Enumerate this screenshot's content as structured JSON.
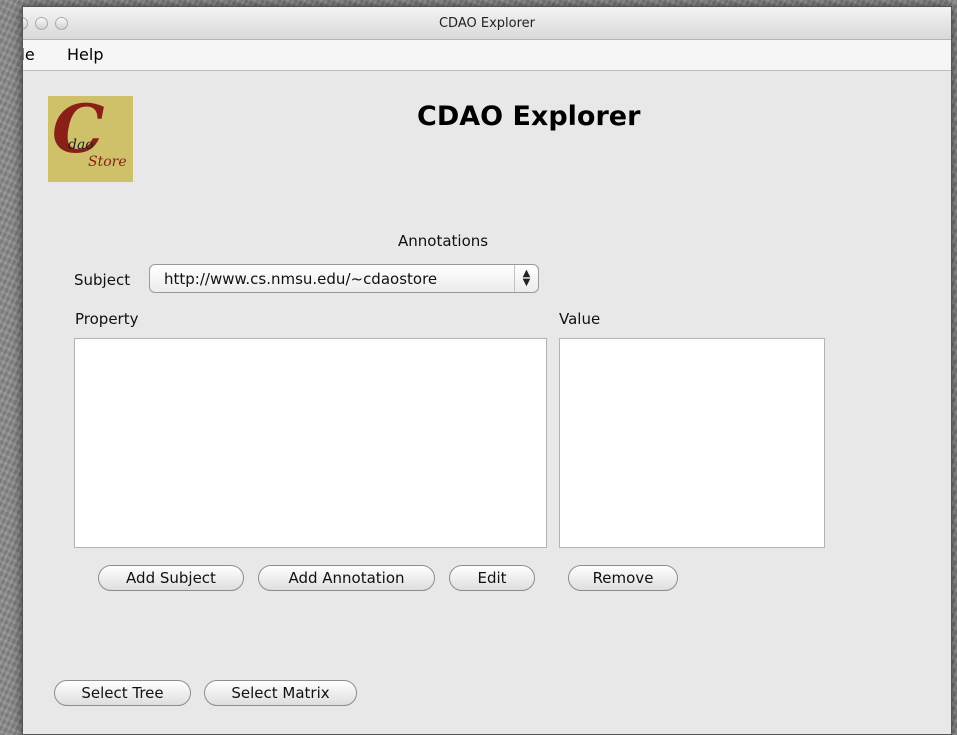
{
  "window": {
    "title": "CDAO Explorer"
  },
  "menu": {
    "items": [
      "File",
      "Help"
    ]
  },
  "logo": {
    "big_letter": "C",
    "line1": "dao",
    "line2": "Store"
  },
  "heading": "CDAO Explorer",
  "annotations": {
    "section_title": "Annotations",
    "subject_label": "Subject",
    "subject_value": "http://www.cs.nmsu.edu/~cdaostore",
    "property_label": "Property",
    "value_label": "Value",
    "buttons": {
      "add_subject": "Add Subject",
      "add_annotation": "Add Annotation",
      "edit": "Edit",
      "remove": "Remove"
    }
  },
  "bottom_buttons": {
    "select_tree": "Select Tree",
    "select_matrix": "Select Matrix"
  },
  "icons": {
    "traffic_lights": "window-control-icons",
    "select_arrows": "up-down-arrows-icon"
  }
}
